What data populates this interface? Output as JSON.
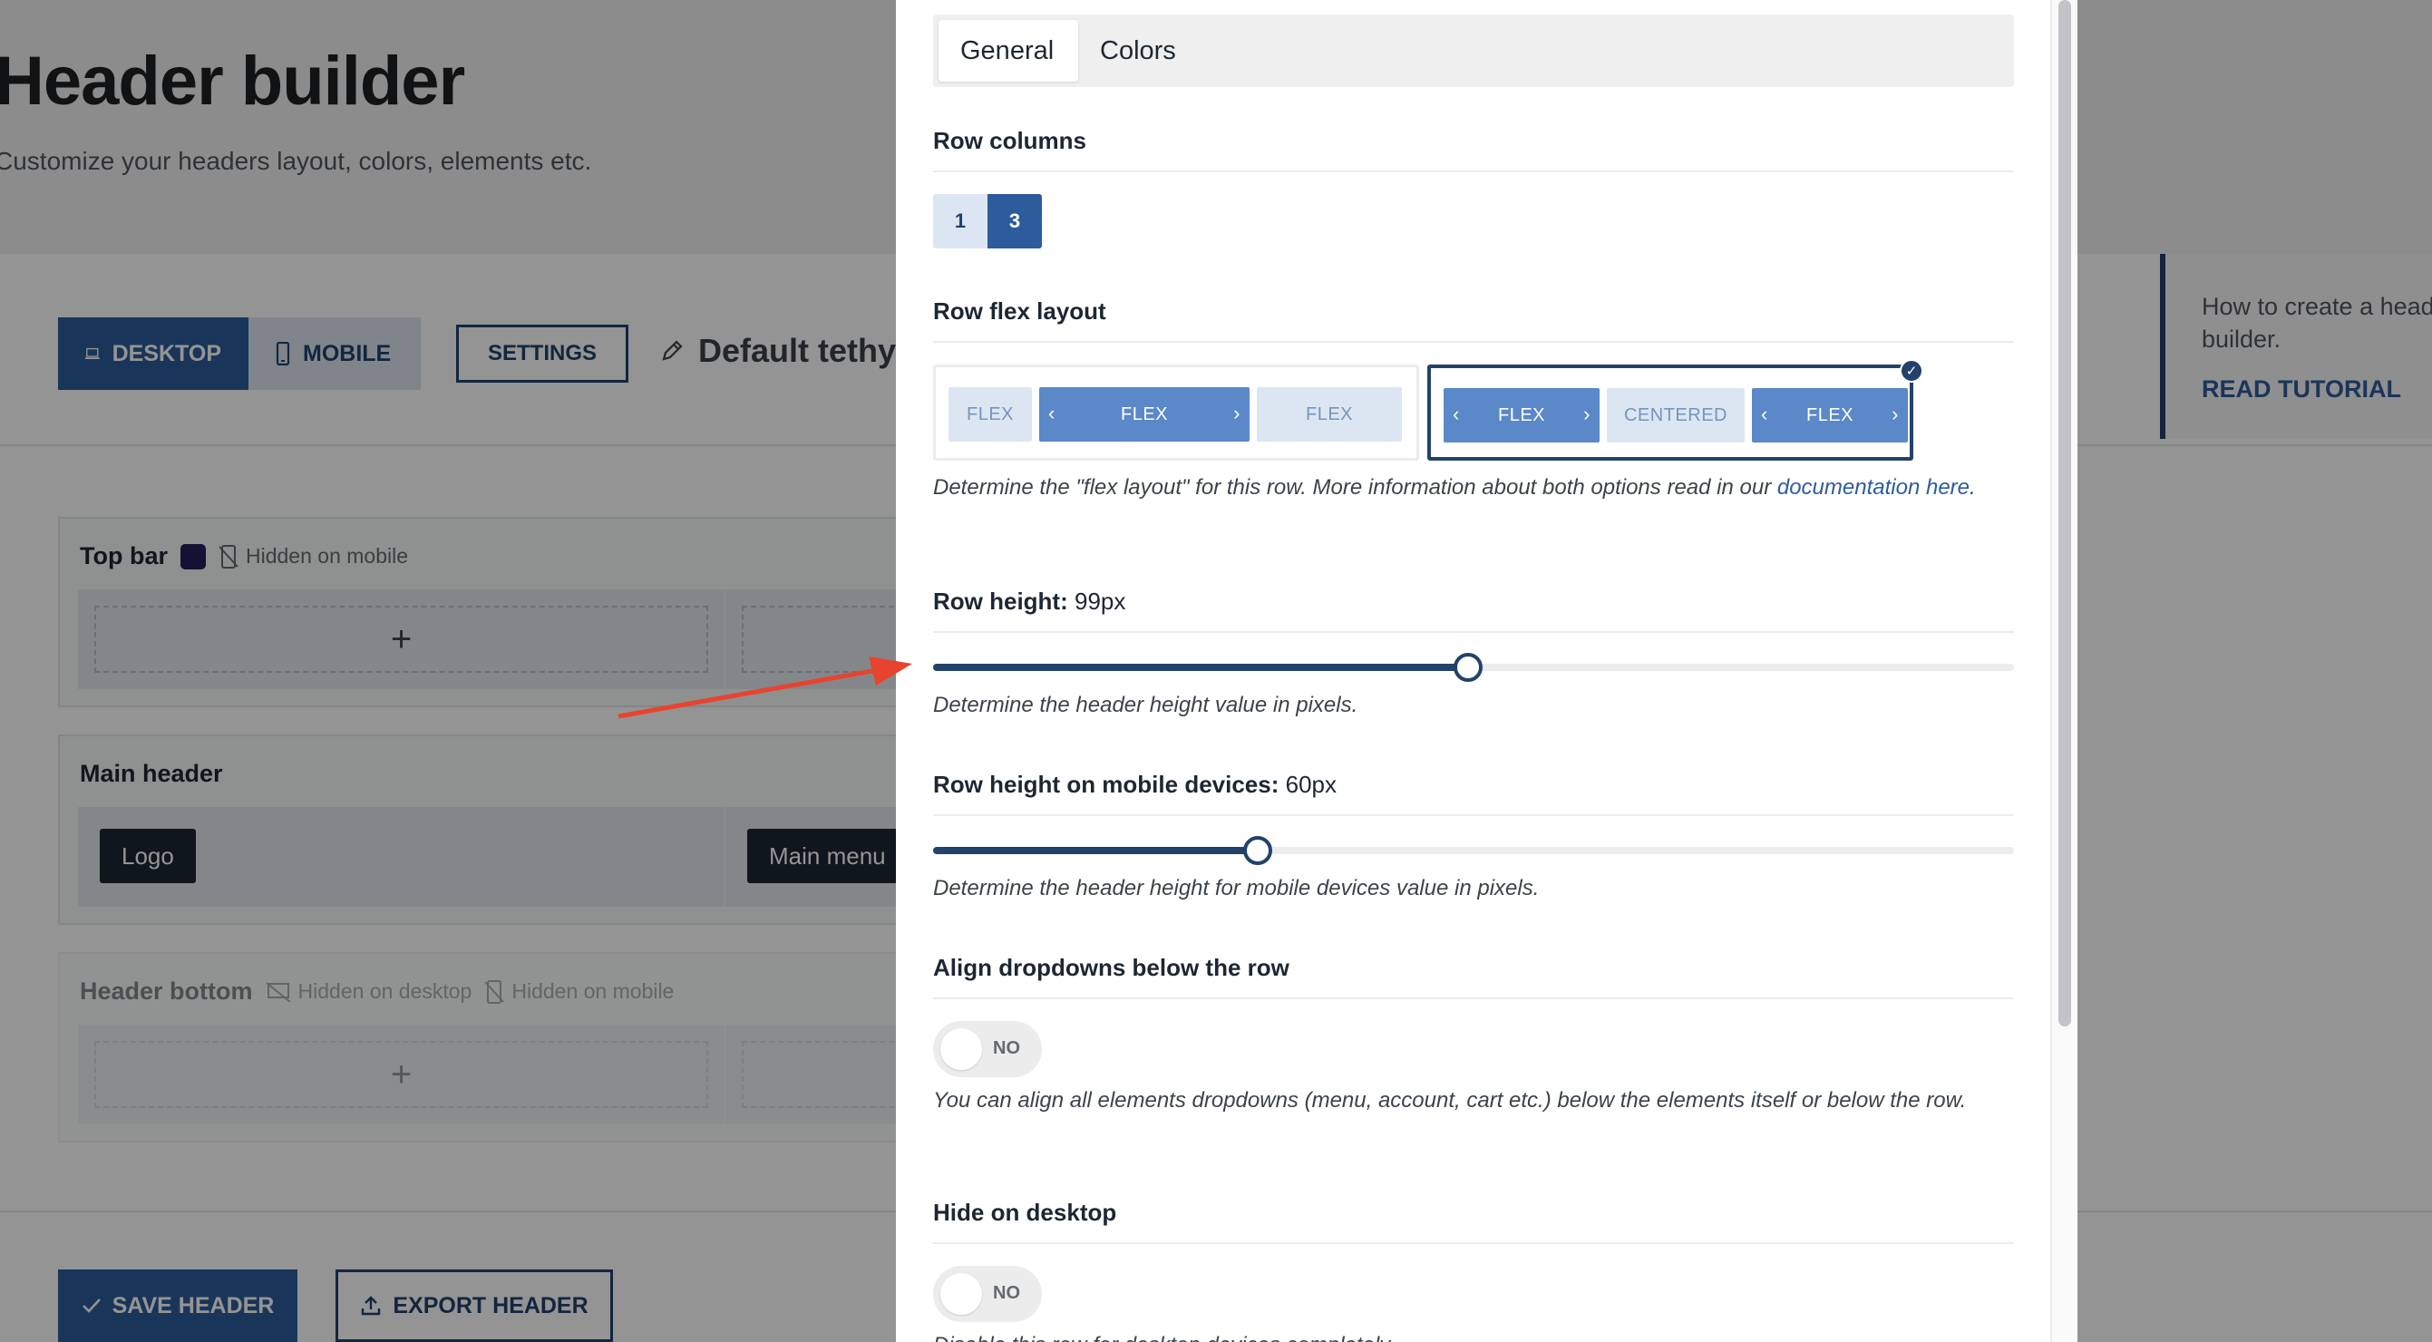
{
  "page": {
    "title": "Header builder",
    "subtitle": "Customize your headers layout, colors, elements etc.",
    "device_tabs": {
      "desktop": "DESKTOP",
      "mobile": "MOBILE"
    },
    "settings_label": "SETTINGS",
    "header_name": "Default tethys",
    "rows": {
      "top_bar": {
        "title": "Top bar",
        "note_mobile": "Hidden on mobile"
      },
      "main_header": {
        "title": "Main header",
        "logo": "Logo",
        "menu": "Main menu"
      },
      "header_bottom": {
        "title": "Header bottom",
        "note_desktop": "Hidden on desktop",
        "note_mobile": "Hidden on mobile"
      }
    },
    "save_label": "SAVE HEADER",
    "export_label": "EXPORT HEADER",
    "tutorial": {
      "text_line1": "How to create a header",
      "text_line2": "builder.",
      "link": "READ TUTORIAL"
    }
  },
  "panel": {
    "tabs": [
      {
        "label": "General"
      },
      {
        "label": "Colors"
      }
    ],
    "row_columns": {
      "title": "Row columns",
      "options": [
        "1",
        "3"
      ],
      "selected": "3"
    },
    "row_flex_layout": {
      "title": "Row flex layout",
      "option_flex": [
        "FLEX",
        "FLEX",
        "FLEX"
      ],
      "option_centered": [
        "FLEX",
        "CENTERED",
        "FLEX"
      ],
      "selected": "centered",
      "desc_before": "Determine the \"flex layout\" for this row. More information about both options read in our ",
      "desc_link": "documentation here",
      "desc_after": "."
    },
    "row_height": {
      "title": "Row height:",
      "value": "99px",
      "fraction": 0.495,
      "desc": "Determine the header height value in pixels."
    },
    "row_height_mobile": {
      "title": "Row height on mobile devices:",
      "value": "60px",
      "fraction": 0.3,
      "desc": "Determine the header height for mobile devices value in pixels."
    },
    "align_dropdowns": {
      "title": "Align dropdowns below the row",
      "toggle": "NO",
      "desc": "You can align all elements dropdowns (menu, account, cart etc.) below the elements itself or below the row."
    },
    "hide_desktop": {
      "title": "Hide on desktop",
      "toggle": "NO",
      "desc": "Disable this row for desktop devices completely."
    }
  },
  "colors": {
    "accent": "#2d5c9c",
    "dark_accent": "#22426c",
    "top_bar_swatch": "#23205a",
    "annotation_arrow": "#e8432f"
  },
  "icons": {
    "desktop": "laptop-icon",
    "mobile": "phone-icon",
    "edit": "pencil-icon",
    "hidden": "hidden-device-icon",
    "add": "plus-icon",
    "save": "check-icon",
    "export": "upload-icon",
    "selected": "checkmark-badge-icon"
  }
}
